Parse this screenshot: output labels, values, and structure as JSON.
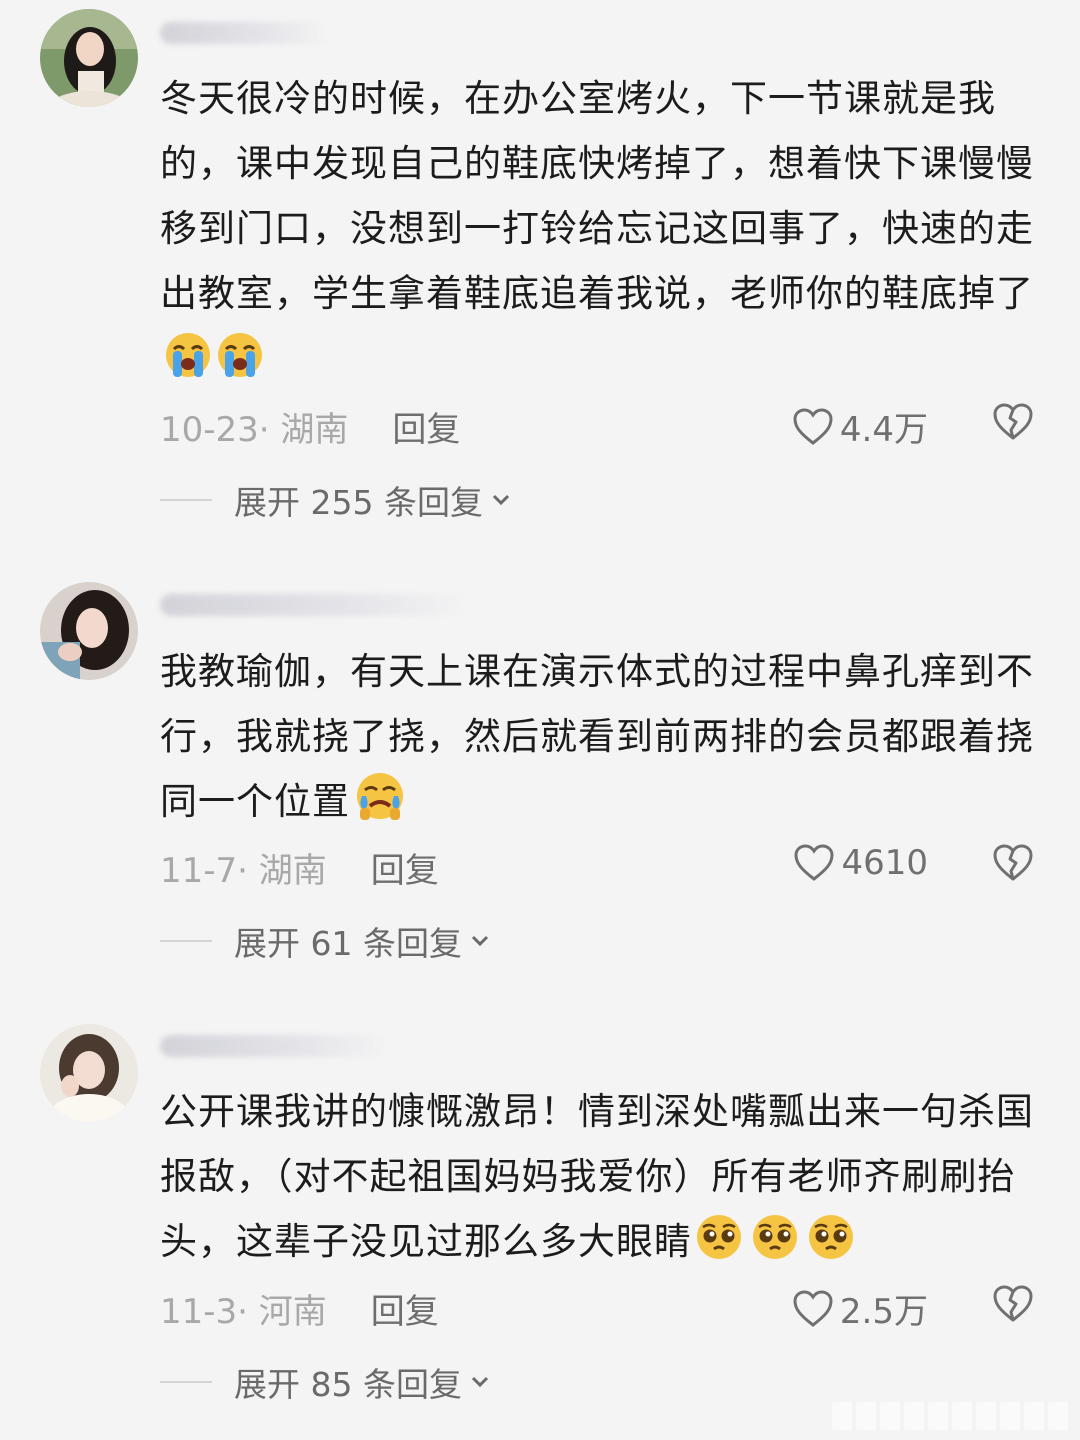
{
  "comments": [
    {
      "text": "冬天很冷的时候，在办公室烤火，下一节课就是我的，课中发现自己的鞋底快烤掉了，想着快下课慢慢移到门口，没想到一打铃给忘记这回事了，快速的走出教室，学生拿着鞋底追着我说，老师你的鞋底掉了",
      "emojis": [
        "loudly-crying-face",
        "loudly-crying-face"
      ],
      "date_location": "10-23· 湖南",
      "reply_label": "回复",
      "likes": "4.4万",
      "expand_label": "展开 255 条回复"
    },
    {
      "text": "我教瑜伽，有天上课在演示体式的过程中鼻孔痒到不行，我就挠了挠，然后就看到前两排的会员都跟着挠同一个位置",
      "emojis": [
        "face-holding-back-tears"
      ],
      "date_location": "11-7· 湖南",
      "reply_label": "回复",
      "likes": "4610",
      "expand_label": "展开 61 条回复"
    },
    {
      "text": "公开课我讲的慷慨激昂！情到深处嘴瓢出来一句杀国报敌，（对不起祖国妈妈我爱你）所有老师齐刷刷抬头，这辈子没见过那么多大眼睛",
      "emojis": [
        "pleading-face",
        "pleading-face",
        "pleading-face"
      ],
      "date_location": "11-3· 河南",
      "reply_label": "回复",
      "likes": "2.5万",
      "expand_label": "展开 85 条回复"
    }
  ],
  "colors": {
    "background": "#f4f4f4",
    "text": "#1c1c1c",
    "meta": "#a8a8a8",
    "emoji_yellow": "#f6c443",
    "tears_blue": "#4aa3e8"
  },
  "icons": [
    "heart-outline-icon",
    "broken-heart-icon",
    "chevron-down-icon"
  ]
}
